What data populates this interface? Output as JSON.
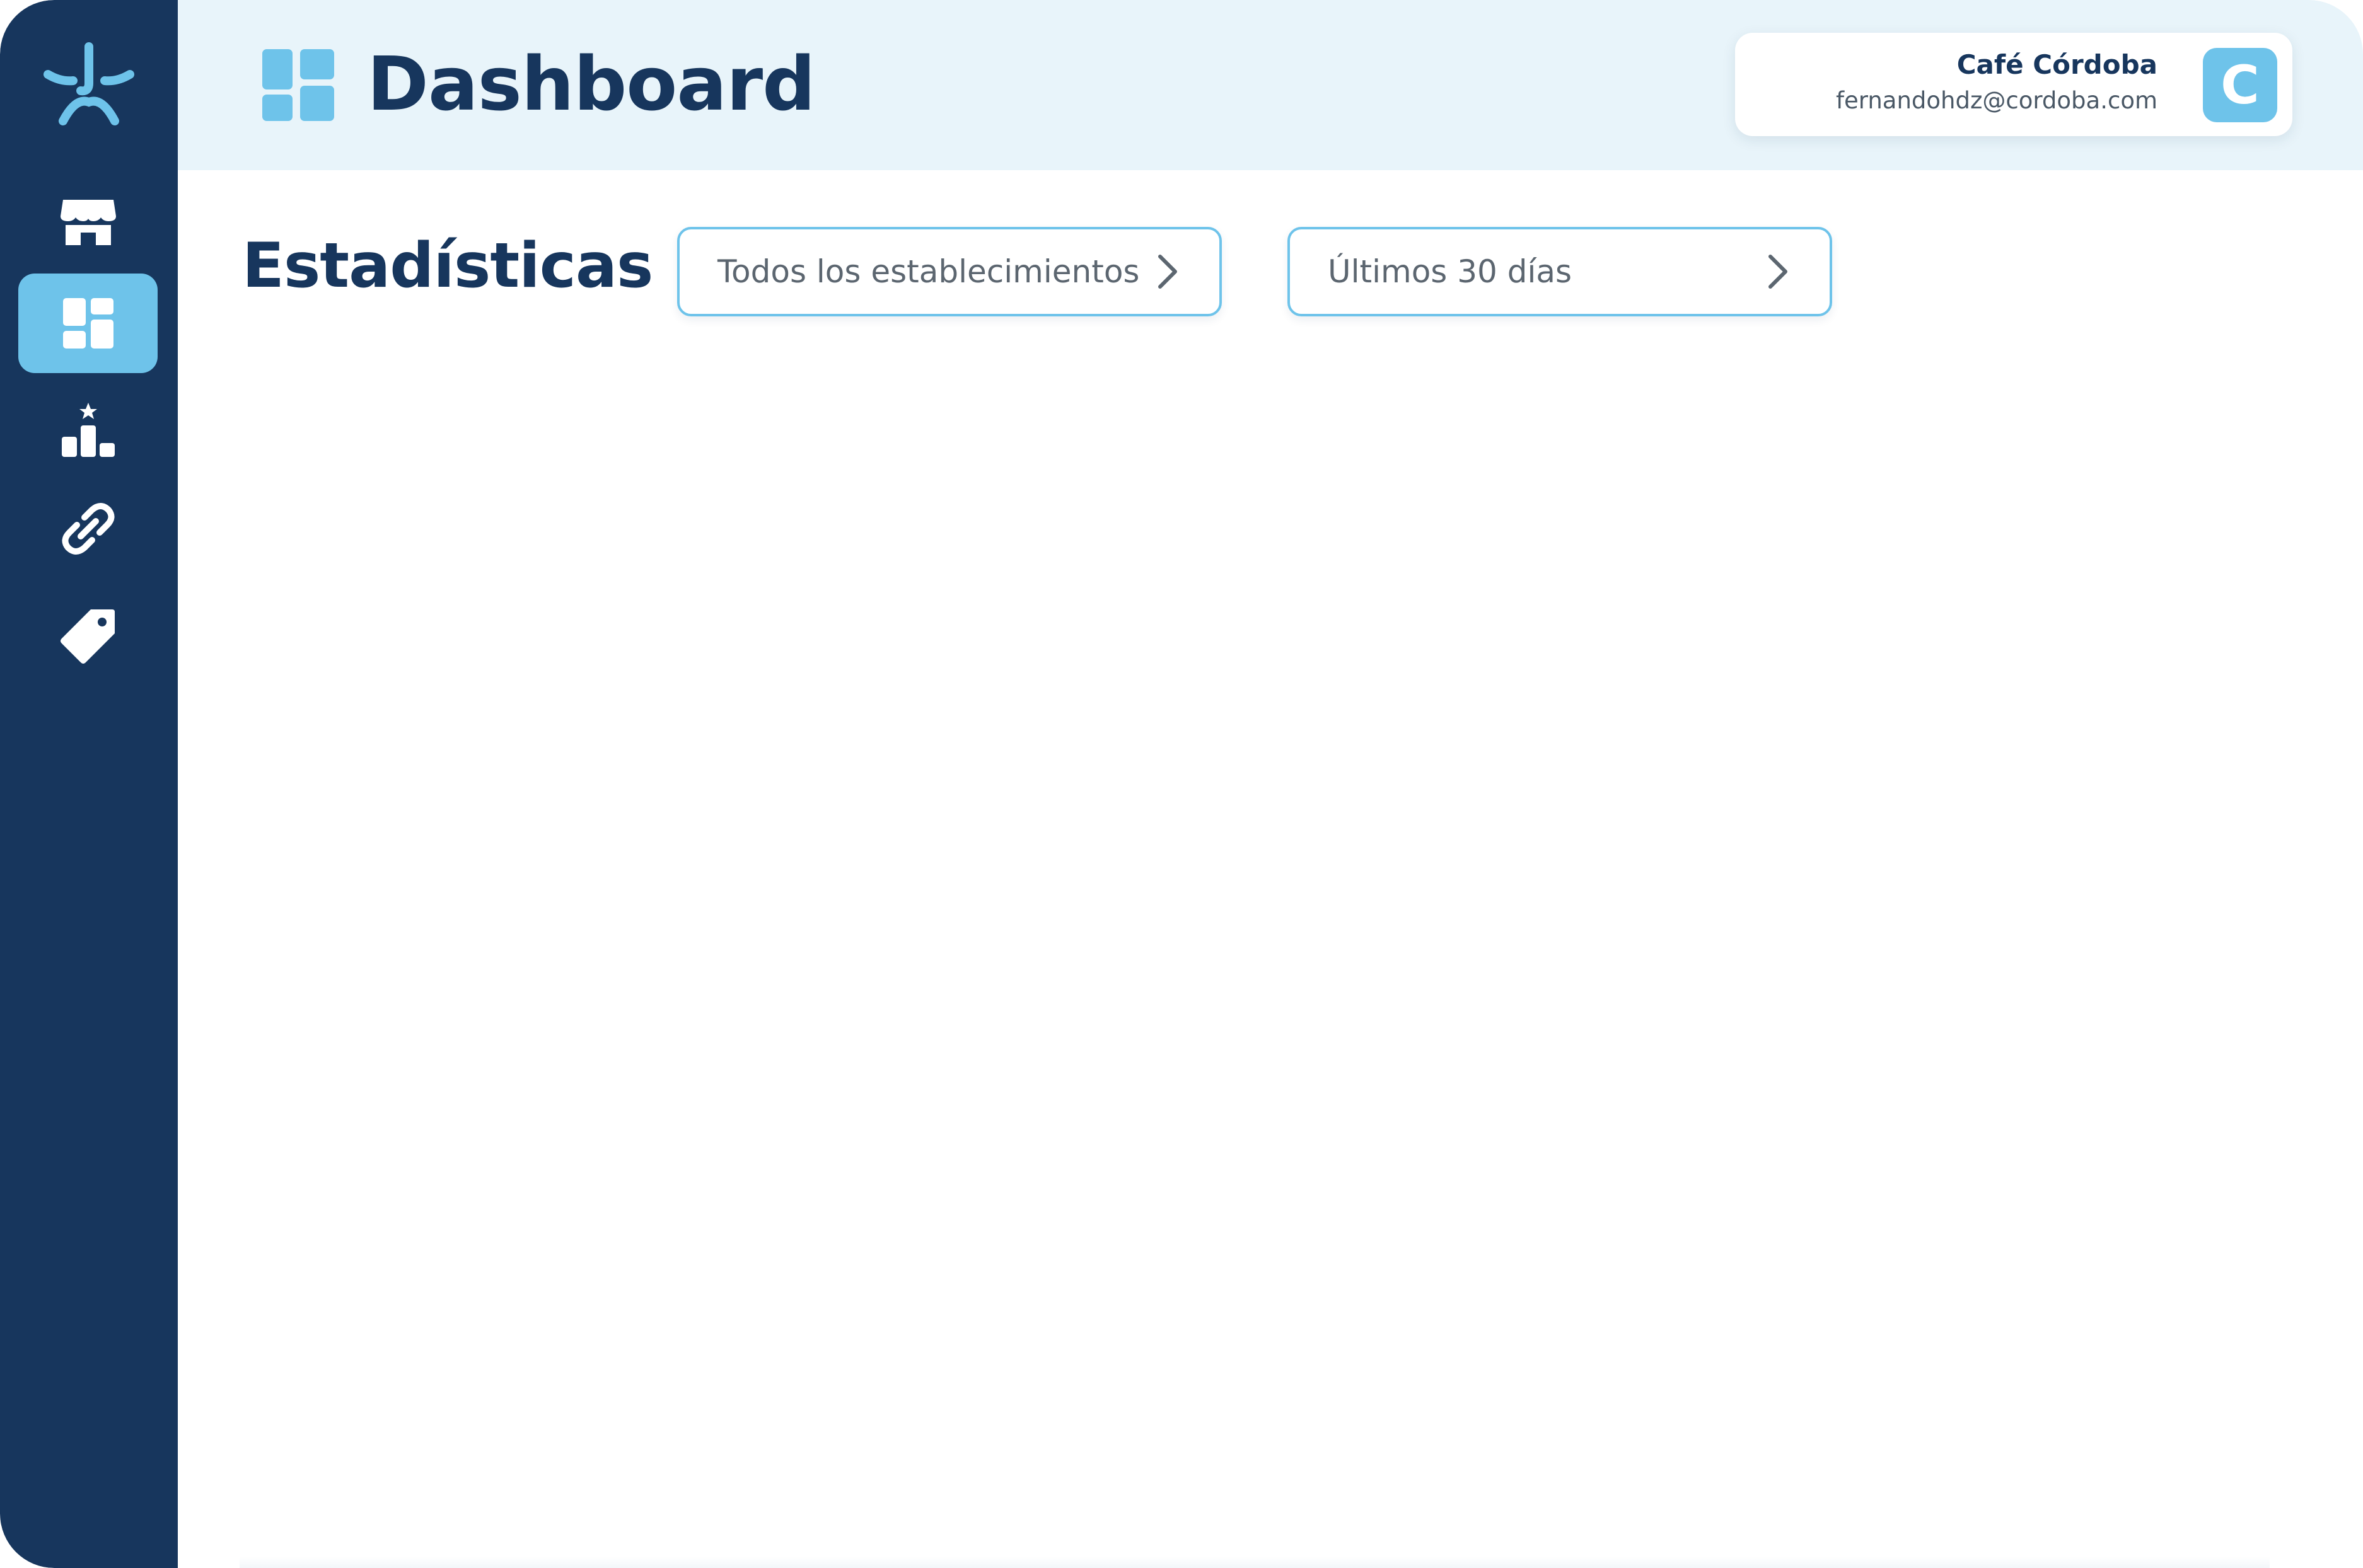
{
  "header": {
    "title": "Dashboard"
  },
  "user": {
    "name": "Café Córdoba",
    "email": "fernandohdz@cordoba.com",
    "avatar_initial": "C"
  },
  "main": {
    "section_title": "Estadísticas",
    "filters": [
      {
        "label": "Todos los establecimientos",
        "icon": "chevron-right-icon"
      },
      {
        "label": "Últimos 30 días",
        "icon": "chevron-right-icon"
      }
    ]
  },
  "sidebar": {
    "items": [
      {
        "name": "store",
        "icon": "store-icon",
        "active": false
      },
      {
        "name": "dashboard",
        "icon": "dashboard-icon",
        "active": true
      },
      {
        "name": "ranking",
        "icon": "podium-icon",
        "active": false
      },
      {
        "name": "links",
        "icon": "link-icon",
        "active": false
      },
      {
        "name": "tags",
        "icon": "tag-icon",
        "active": false
      }
    ]
  },
  "colors": {
    "sidebar": "#17365d",
    "accent": "#6ec3ea",
    "header_bg": "#e8f4fa",
    "title": "#17365d"
  }
}
